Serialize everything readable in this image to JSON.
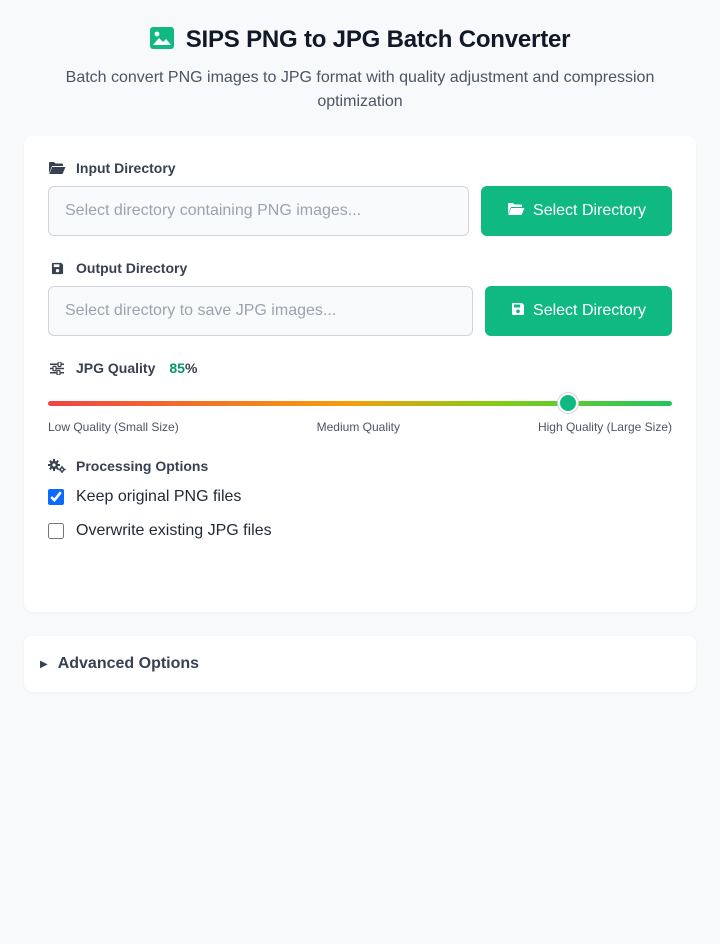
{
  "header": {
    "title": "SIPS PNG to JPG Batch Converter",
    "subtitle": "Batch convert PNG images to JPG format with quality adjustment and compression optimization",
    "icon": "image-icon"
  },
  "input_dir": {
    "label": "Input Directory",
    "placeholder": "Select directory containing PNG images...",
    "value": "",
    "button_label": "Select Directory",
    "icon": "folder-open-icon"
  },
  "output_dir": {
    "label": "Output Directory",
    "placeholder": "Select directory to save JPG images...",
    "value": "",
    "button_label": "Select Directory",
    "icon": "save-icon"
  },
  "quality": {
    "label": "JPG Quality",
    "value": 85,
    "unit": "%",
    "min_label": "Low Quality (Small Size)",
    "mid_label": "Medium Quality",
    "max_label": "High Quality (Large Size)",
    "icon": "sliders-icon"
  },
  "processing": {
    "label": "Processing Options",
    "icon": "gears-icon",
    "options": [
      {
        "label": "Keep original PNG files",
        "checked": true
      },
      {
        "label": "Overwrite existing JPG files",
        "checked": false
      }
    ]
  },
  "advanced": {
    "label": "Advanced Options",
    "expanded": false
  },
  "colors": {
    "accent": "#10b981",
    "quality_value": "#059669",
    "checkbox": "#0b6bff"
  }
}
